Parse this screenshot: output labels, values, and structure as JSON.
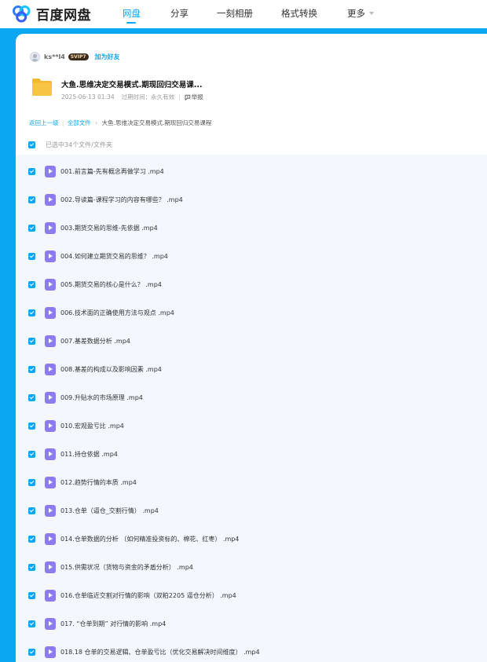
{
  "app": {
    "logo_text": "百度网盘"
  },
  "nav": {
    "items": [
      {
        "label": "网盘",
        "active": true
      },
      {
        "label": "分享",
        "active": false
      },
      {
        "label": "一刻相册",
        "active": false
      },
      {
        "label": "格式转换",
        "active": false
      },
      {
        "label": "更多",
        "active": false
      }
    ]
  },
  "sharer": {
    "name": "ks**l4",
    "badge": "SVIP7",
    "add_friend": "加为好友"
  },
  "share": {
    "title": "大鱼.思维决定交易模式.期现回归交易课...",
    "time": "2025-06-13 01:34",
    "expire": "过期时间：永久有效",
    "report": "举报"
  },
  "breadcrumb": {
    "back": "返回上一级",
    "all": "全部文件",
    "current": "大鱼.思维决定交易模式.期现回归交易课程"
  },
  "selection": {
    "label": "已选中34个文件/文件夹"
  },
  "files": [
    {
      "name": "001.前言篇-先有概念再做学习 .mp4"
    },
    {
      "name": "002.导读篇-课程学习的内容有哪些？ .mp4"
    },
    {
      "name": "003.期货交易的思维-先依据 .mp4"
    },
    {
      "name": "004.如何建立期货交易的思维？ .mp4"
    },
    {
      "name": "005.期货交易的核心是什么？ .mp4"
    },
    {
      "name": "006.技术面的正确使用方法与观点 .mp4"
    },
    {
      "name": "007.基差数据分析 .mp4"
    },
    {
      "name": "008.基差的构成以及影响因素 .mp4"
    },
    {
      "name": "009.升贴水的市场原理 .mp4"
    },
    {
      "name": "010.宏观盈亏比 .mp4"
    },
    {
      "name": "011.持仓依据 .mp4"
    },
    {
      "name": "012.趋势行情的本质 .mp4"
    },
    {
      "name": "013.仓单（逼仓_交割行情） .mp4"
    },
    {
      "name": "014.仓单数据的分析 （如何精准投资标的、棉花、红枣） .mp4"
    },
    {
      "name": "015.供需状况（货物与资金的矛盾分析） .mp4"
    },
    {
      "name": "016.仓单临近交割对行情的影响（双粕2205 逼仓分析） .mp4"
    },
    {
      "name": "017. “仓单到期” 对行情的影响 .mp4"
    },
    {
      "name": "018.18 仓单的交易逻辑、仓单盈亏比（优化交易解决时间维度） .mp4"
    }
  ],
  "colors": {
    "accent": "#06a7ff",
    "page_background": "#0ba7f3",
    "list_background": "#f2f8fd",
    "video_icon": "#8b7cf6",
    "folder": "#f8c443"
  }
}
